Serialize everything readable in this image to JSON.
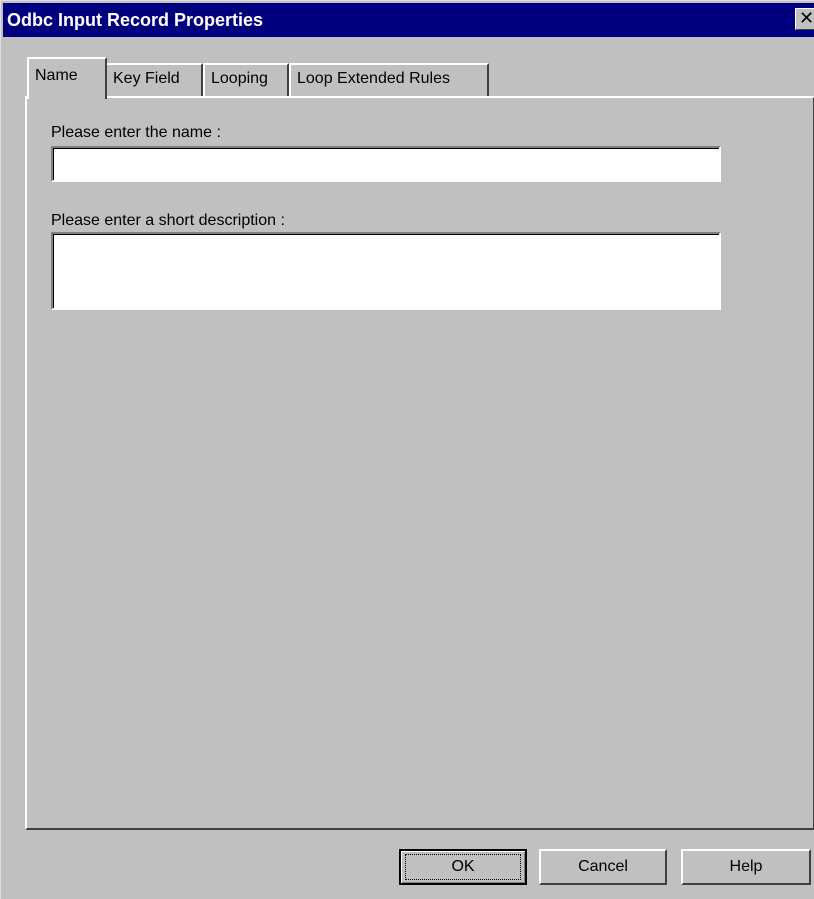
{
  "window": {
    "title": "Odbc Input Record Properties",
    "close_glyph": "✕"
  },
  "tabs": [
    {
      "label": "Name",
      "active": true
    },
    {
      "label": "Key Field",
      "active": false
    },
    {
      "label": "Looping",
      "active": false
    },
    {
      "label": "Loop Extended Rules",
      "active": false
    }
  ],
  "form": {
    "name_label": "Please enter the name :",
    "name_value": "",
    "description_label": "Please enter a short description :",
    "description_value": ""
  },
  "buttons": {
    "ok_label": "OK",
    "cancel_label": "Cancel",
    "help_label": "Help"
  },
  "colors": {
    "titlebar": "#00007f",
    "face": "#c0c0c0"
  }
}
